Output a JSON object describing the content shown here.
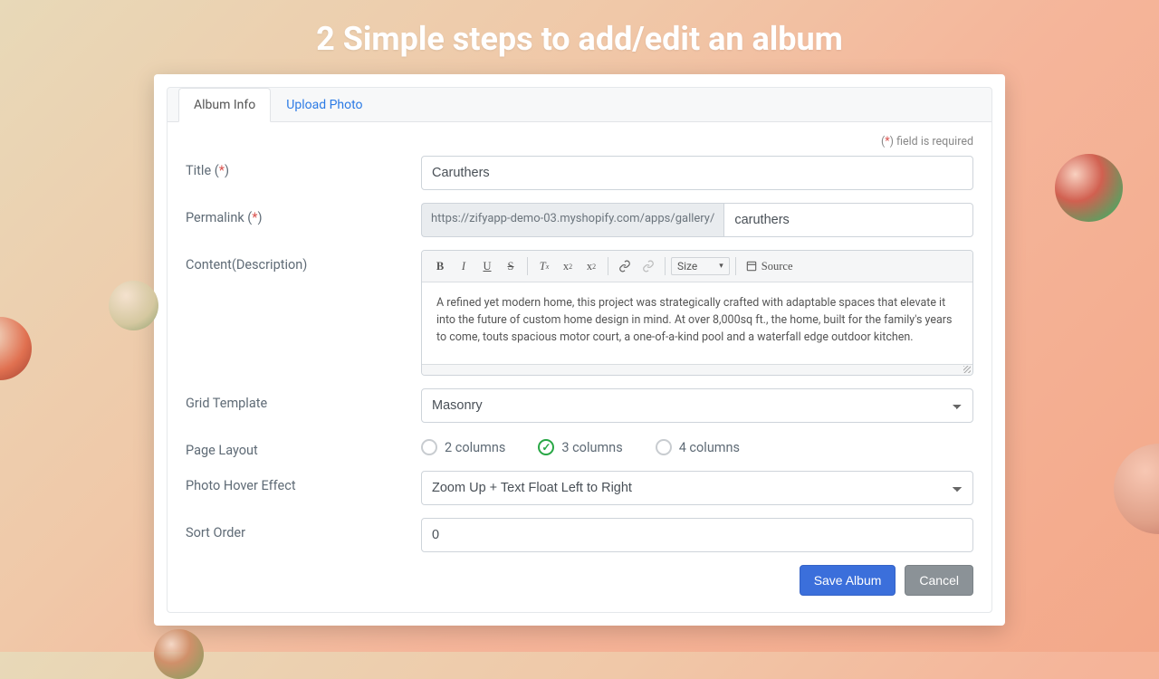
{
  "heading": "2 Simple steps to add/edit an album",
  "tabs": {
    "album_info": "Album Info",
    "upload_photo": "Upload Photo"
  },
  "required_note": {
    "prefix": "(",
    "mark": "*",
    "suffix": ") field is required"
  },
  "labels": {
    "title": "Title (",
    "title_mark": "*",
    "title_end": ")",
    "permalink": "Permalink (",
    "permalink_mark": "*",
    "permalink_end": ")",
    "content": "Content(Description)",
    "grid_template": "Grid Template",
    "page_layout": "Page Layout",
    "hover": "Photo Hover Effect",
    "sort": "Sort Order"
  },
  "fields": {
    "title_value": "Caruthers",
    "permalink_prefix": "https://zifyapp-demo-03.myshopify.com/apps/gallery/",
    "permalink_value": "caruthers",
    "description": "A refined yet modern home, this project was strategically crafted with adaptable spaces that elevate it into the future of custom home design in mind. At over 8,000sq ft., the home, built for the family's years to come, touts spacious motor court, a one-of-a-kind pool and a waterfall edge outdoor kitchen.",
    "grid_template": "Masonry",
    "hover_effect": "Zoom Up + Text Float Left to Right",
    "sort_order": "0"
  },
  "layout_options": [
    "2 columns",
    "3 columns",
    "4 columns"
  ],
  "layout_selected": "3 columns",
  "toolbar": {
    "size_label": "Size",
    "source_label": "Source"
  },
  "buttons": {
    "save": "Save Album",
    "cancel": "Cancel"
  }
}
